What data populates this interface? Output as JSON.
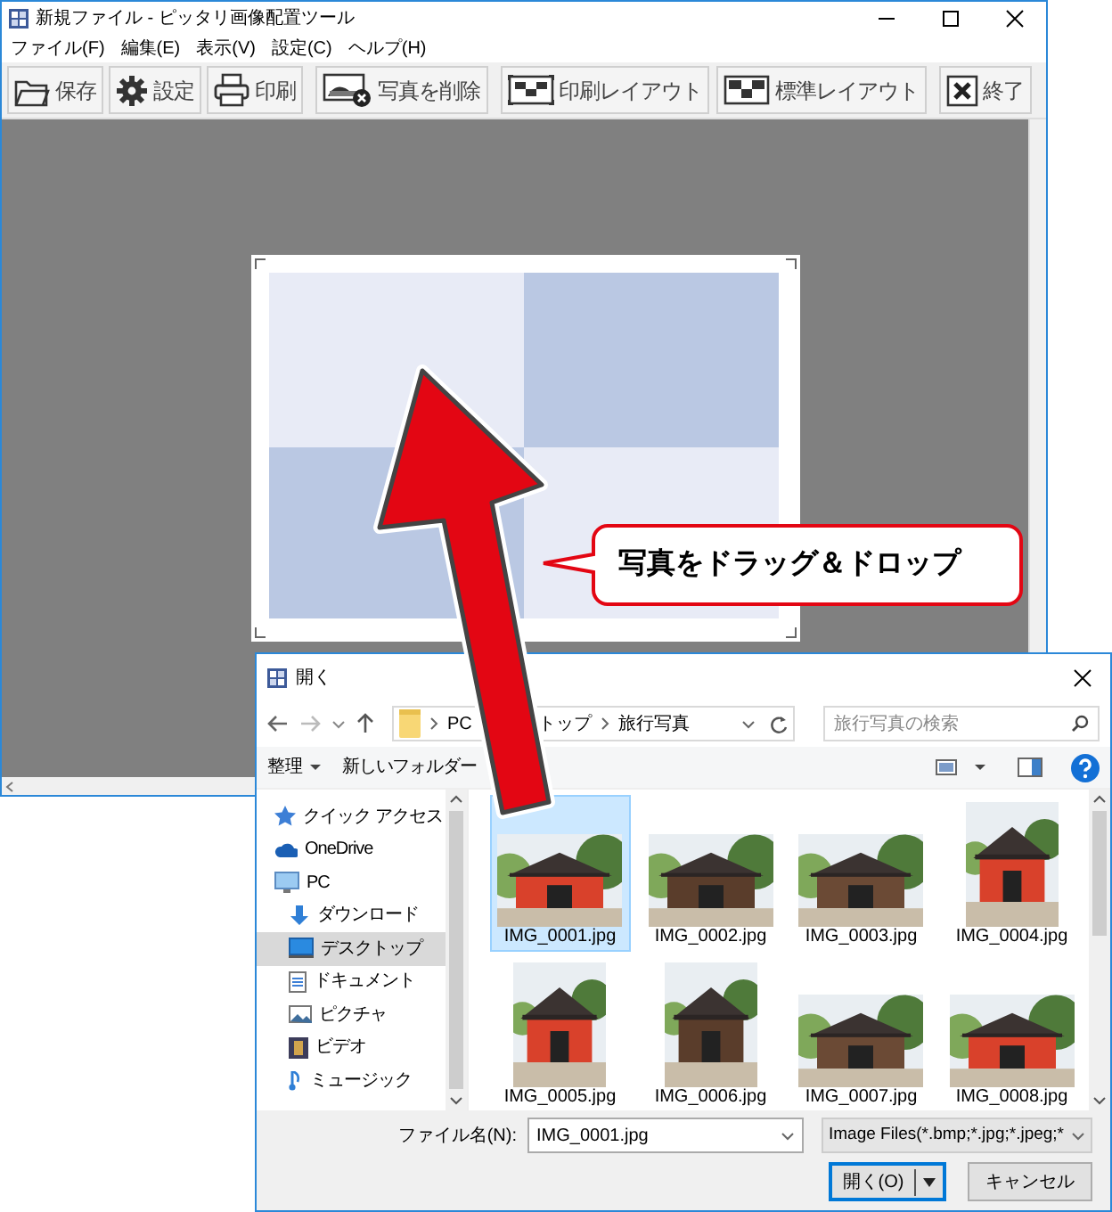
{
  "window": {
    "title": "新規ファイル - ピッタリ画像配置ツール"
  },
  "menu": [
    "ファイル(F)",
    "編集(E)",
    "表示(V)",
    "設定(C)",
    "ヘルプ(H)"
  ],
  "toolbar": [
    {
      "label": "保存",
      "kind": "save"
    },
    {
      "label": "設定",
      "kind": "settings"
    },
    {
      "label": "印刷",
      "kind": "print"
    },
    {
      "label": "写真を削除",
      "kind": "delete_photo"
    },
    {
      "label": "印刷レイアウト",
      "kind": "print_layout"
    },
    {
      "label": "標準レイアウト",
      "kind": "standard_layout"
    },
    {
      "label": "終了",
      "kind": "exit"
    }
  ],
  "callout": {
    "text": "写真をドラッグ＆ドロップ"
  },
  "dialog": {
    "title": "開く",
    "breadcrumb": [
      "PC",
      "トップ",
      "旅行写真"
    ],
    "search": {
      "placeholder": "旅行写真の検索"
    },
    "toolbar": {
      "organize": "整理",
      "new_folder": "新しいフォルダー"
    },
    "sidebar": {
      "items": [
        {
          "label": "クイック アクセス",
          "kind": "quick_access",
          "selected": false
        },
        {
          "label": "OneDrive",
          "kind": "cloud",
          "selected": false
        },
        {
          "label": "PC",
          "kind": "pc",
          "selected": false,
          "children": [
            {
              "label": "ダウンロード",
              "kind": "download",
              "selected": false
            },
            {
              "label": "デスクトップ",
              "kind": "desktop",
              "selected": true
            },
            {
              "label": "ドキュメント",
              "kind": "documents",
              "selected": false
            },
            {
              "label": "ピクチャ",
              "kind": "pictures",
              "selected": false
            },
            {
              "label": "ビデオ",
              "kind": "videos",
              "selected": false
            },
            {
              "label": "ミュージック",
              "kind": "music",
              "selected": false
            }
          ]
        }
      ]
    },
    "files": [
      {
        "name": "IMG_0001.jpg",
        "selected": true
      },
      {
        "name": "IMG_0002.jpg",
        "selected": false
      },
      {
        "name": "IMG_0003.jpg",
        "selected": false
      },
      {
        "name": "IMG_0004.jpg",
        "selected": false
      },
      {
        "name": "IMG_0005.jpg",
        "selected": false
      },
      {
        "name": "IMG_0006.jpg",
        "selected": false
      },
      {
        "name": "IMG_0007.jpg",
        "selected": false
      },
      {
        "name": "IMG_0008.jpg",
        "selected": false
      }
    ],
    "file_name": {
      "label": "ファイル名(N):",
      "value": "IMG_0001.jpg"
    },
    "file_type": "Image Files(*.bmp;*.jpg;*.jpeg;*",
    "buttons": {
      "open": "開く(O)",
      "cancel": "キャンセル"
    }
  }
}
